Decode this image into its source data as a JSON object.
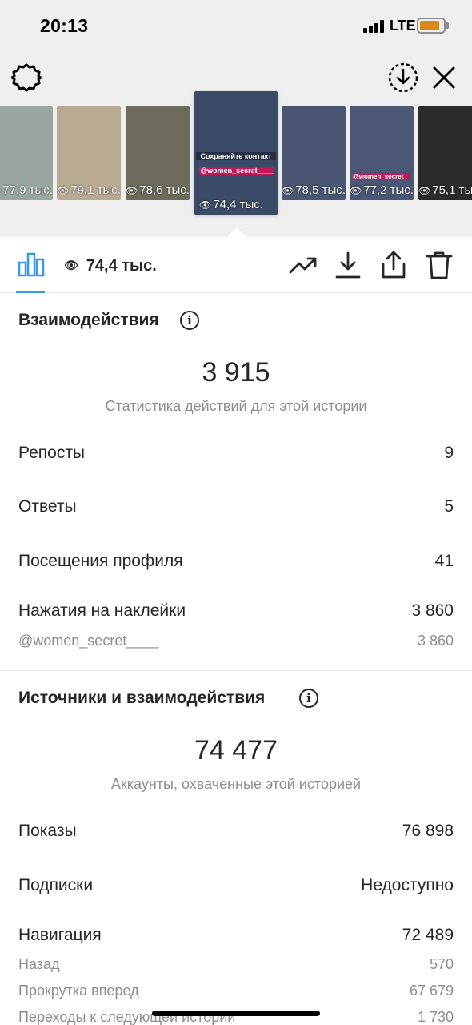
{
  "status_bar": {
    "time": "20:13",
    "network": "LTE"
  },
  "thumbnails": [
    {
      "views": "77,9 тыс.",
      "selected": false,
      "bg": "#9aa6a0"
    },
    {
      "views": "79,1 тыс.",
      "selected": false,
      "bg": "#b9aa94"
    },
    {
      "views": "78,6 тыс.",
      "selected": false,
      "bg": "#6e6a5c"
    },
    {
      "views": "74,4 тыс.",
      "selected": true,
      "bg": "#3b4a66",
      "caption": "Сохраняйте контакт",
      "tag": "@women_secret____"
    },
    {
      "views": "78,5 тыс.",
      "selected": false,
      "bg": "#4a5672"
    },
    {
      "views": "77,2 тыс.",
      "selected": false,
      "bg": "#4b5775",
      "tag": "@women_secret____"
    },
    {
      "views": "75,1 тыс.",
      "selected": false,
      "bg": "#2b2b2b"
    }
  ],
  "toolbar": {
    "views": "74,4 тыс.",
    "icons": [
      "bar-chart-icon",
      "eye-icon",
      "trending-icon",
      "download-icon",
      "share-icon",
      "trash-icon"
    ]
  },
  "interactions": {
    "title": "Взаимодействия",
    "total": "3 915",
    "total_caption": "Статистика действий для этой истории",
    "rows": [
      {
        "label": "Репосты",
        "value": "9"
      },
      {
        "label": "Ответы",
        "value": "5"
      },
      {
        "label": "Посещения профиля",
        "value": "41"
      },
      {
        "label": "Нажатия на наклейки",
        "value": "3 860"
      }
    ],
    "sticker_detail": {
      "label": "@women_secret____",
      "value": "3 860"
    }
  },
  "discovery": {
    "title": "Источники и взаимодействия",
    "total": "74 477",
    "total_caption": "Аккаунты, охваченные этой историей",
    "rows": [
      {
        "label": "Показы",
        "value": "76 898"
      },
      {
        "label": "Подписки",
        "value": "Недоступно"
      },
      {
        "label": "Навигация",
        "value": "72 489"
      }
    ],
    "navigation_details": [
      {
        "label": "Назад",
        "value": "570"
      },
      {
        "label": "Прокрутка вперед",
        "value": "67 679"
      },
      {
        "label": "Переходы к следующей истории",
        "value": "1 730"
      }
    ]
  },
  "colors": {
    "accent": "#3897f0",
    "battery": "#d7891b",
    "text": "#262626",
    "muted": "#8e8e8e"
  }
}
